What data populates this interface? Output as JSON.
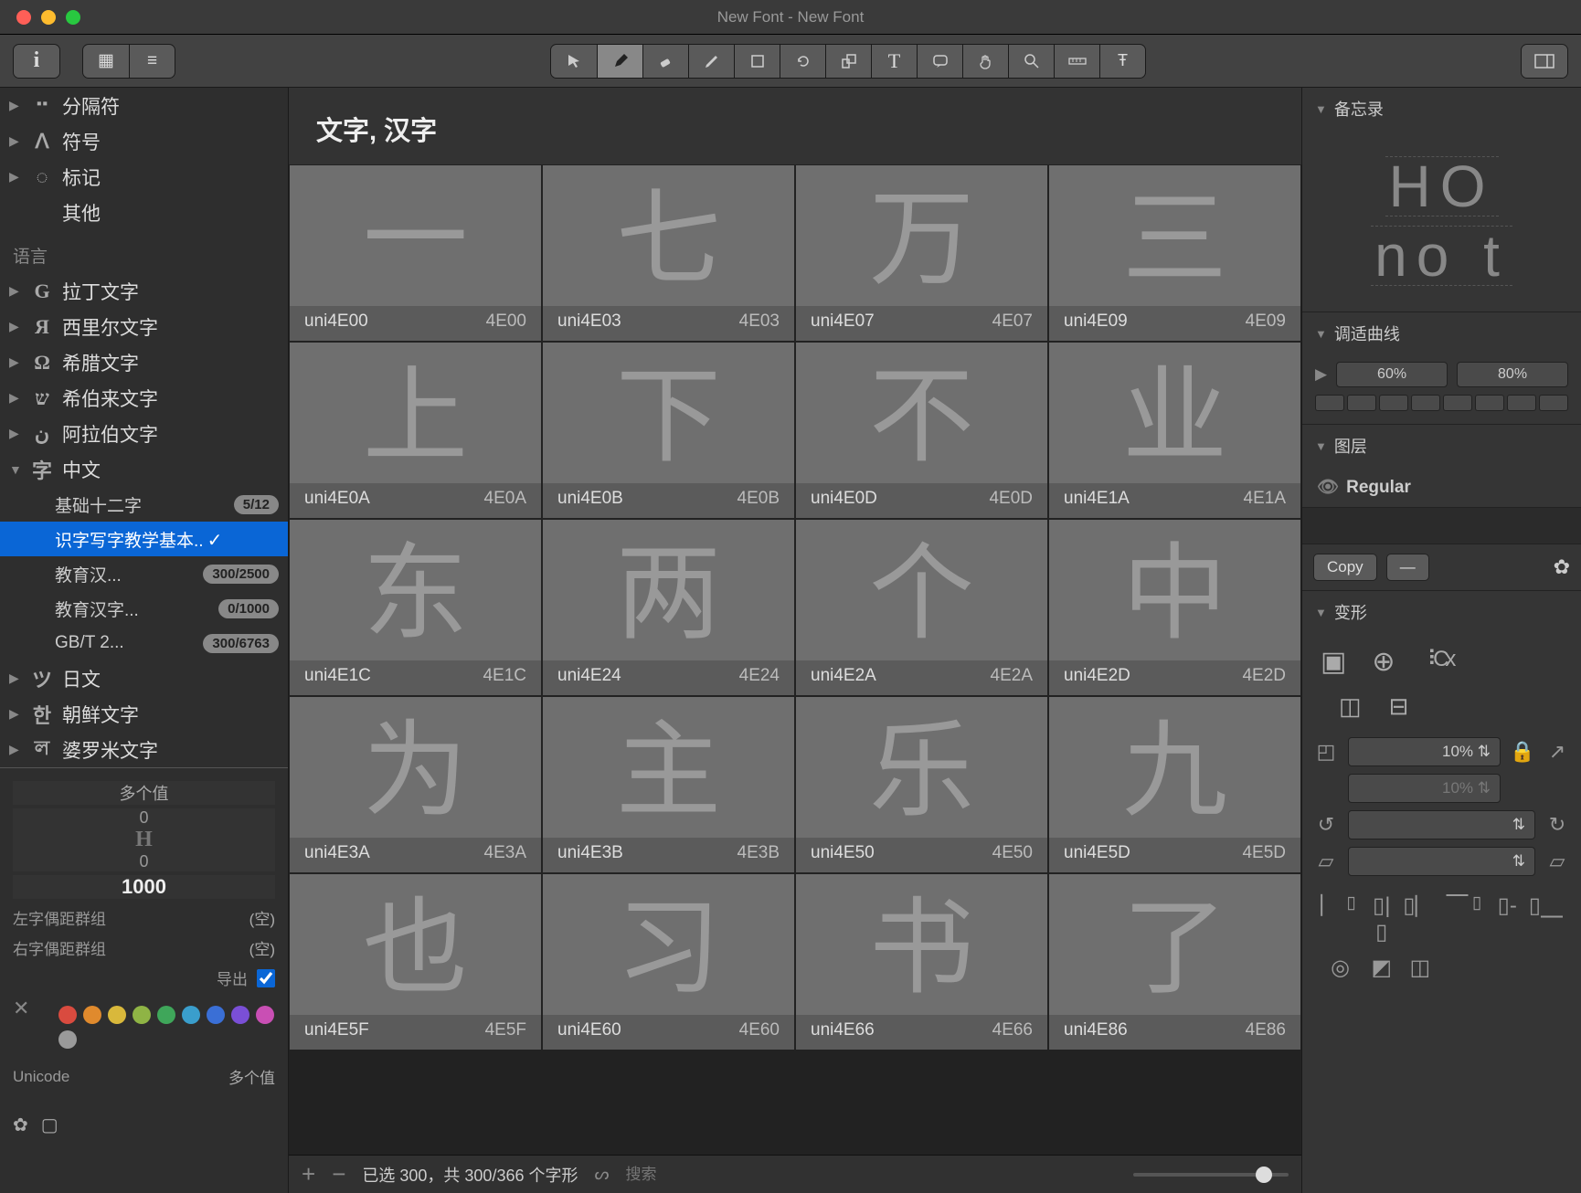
{
  "window": {
    "title": "New Font - New Font"
  },
  "sidebar": {
    "top_items": [
      {
        "icon": "⠒",
        "label": "分隔符"
      },
      {
        "icon": "ⴷ",
        "label": "符号"
      },
      {
        "icon": "◌",
        "label": "标记"
      }
    ],
    "other_label": "其他",
    "lang_header": "语言",
    "langs": [
      {
        "icon": "G",
        "label": "拉丁文字"
      },
      {
        "icon": "Я",
        "label": "西里尔文字"
      },
      {
        "icon": "Ω",
        "label": "希腊文字"
      },
      {
        "icon": "ש",
        "label": "希伯来文字"
      },
      {
        "icon": "ن",
        "label": "阿拉伯文字"
      }
    ],
    "cjk": {
      "icon": "字",
      "label": "中文",
      "subs": [
        {
          "label": "基础十二字",
          "badge": "5/12"
        },
        {
          "label": "识字写字教学基本..",
          "selected": true,
          "check": true
        },
        {
          "label": "教育汉...",
          "badge": "300/2500"
        },
        {
          "label": "教育汉字...",
          "badge": "0/1000"
        },
        {
          "label": "GB/T 2...",
          "badge": "300/6763"
        }
      ]
    },
    "after_langs": [
      {
        "icon": "ツ",
        "label": "日文"
      },
      {
        "icon": "한",
        "label": "朝鲜文字"
      },
      {
        "icon": "ল",
        "label": "婆罗米文字"
      }
    ],
    "info": {
      "multi": "多个值",
      "lsb": "0",
      "rsb": "0",
      "width": "1000",
      "left_group_label": "左字偶距群组",
      "right_group_label": "右字偶距群组",
      "empty": "(空)",
      "export_label": "导出",
      "unicode_label": "Unicode",
      "unicode_val": "多个值",
      "colors": [
        "#d94b3f",
        "#e08a2d",
        "#d9b83b",
        "#8fb445",
        "#3fa65a",
        "#3a9ecc",
        "#3a6fd6",
        "#7a4fd6",
        "#c94fb4",
        "#9a9a9a"
      ]
    }
  },
  "center": {
    "title": "文字, 汉字",
    "cells": [
      {
        "g": "一",
        "n": "uni4E00",
        "c": "4E00"
      },
      {
        "g": "七",
        "n": "uni4E03",
        "c": "4E03"
      },
      {
        "g": "万",
        "n": "uni4E07",
        "c": "4E07"
      },
      {
        "g": "三",
        "n": "uni4E09",
        "c": "4E09"
      },
      {
        "g": "上",
        "n": "uni4E0A",
        "c": "4E0A"
      },
      {
        "g": "下",
        "n": "uni4E0B",
        "c": "4E0B"
      },
      {
        "g": "不",
        "n": "uni4E0D",
        "c": "4E0D"
      },
      {
        "g": "业",
        "n": "uni4E1A",
        "c": "4E1A"
      },
      {
        "g": "东",
        "n": "uni4E1C",
        "c": "4E1C"
      },
      {
        "g": "两",
        "n": "uni4E24",
        "c": "4E24"
      },
      {
        "g": "个",
        "n": "uni4E2A",
        "c": "4E2A"
      },
      {
        "g": "中",
        "n": "uni4E2D",
        "c": "4E2D"
      },
      {
        "g": "为",
        "n": "uni4E3A",
        "c": "4E3A"
      },
      {
        "g": "主",
        "n": "uni4E3B",
        "c": "4E3B"
      },
      {
        "g": "乐",
        "n": "uni4E50",
        "c": "4E50"
      },
      {
        "g": "九",
        "n": "uni4E5D",
        "c": "4E5D"
      },
      {
        "g": "也",
        "n": "uni4E5F",
        "c": "4E5F"
      },
      {
        "g": "习",
        "n": "uni4E60",
        "c": "4E60"
      },
      {
        "g": "书",
        "n": "uni4E66",
        "c": "4E66"
      },
      {
        "g": "了",
        "n": "uni4E86",
        "c": "4E86"
      }
    ],
    "footer": {
      "status": "已选 300，共 300/366 个字形",
      "search_placeholder": "搜索"
    }
  },
  "right": {
    "memo_label": "备忘录",
    "memo_sample1": "HO",
    "memo_sample2": "no t",
    "curve_label": "调适曲线",
    "curve_lo": "60%",
    "curve_hi": "80%",
    "layer_label": "图层",
    "layer_name": "Regular",
    "copy_label": "Copy",
    "copy_dash": "—",
    "transform_label": "变形",
    "scale1": "10%",
    "scale2": "10%"
  }
}
